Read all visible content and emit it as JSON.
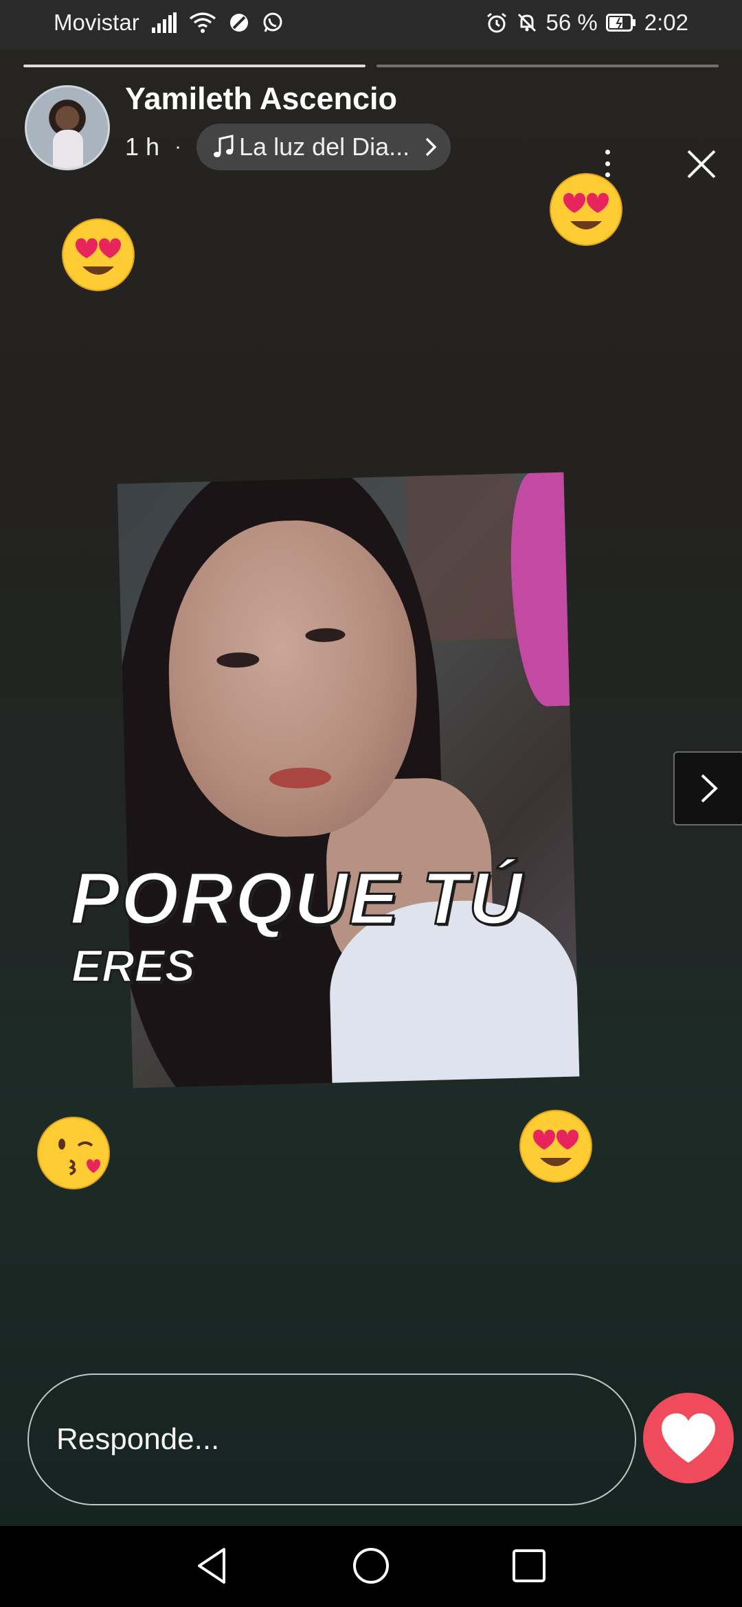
{
  "status_bar": {
    "carrier": "Movistar",
    "battery": "56 %",
    "time": "2:02",
    "icons": [
      "signal-icon",
      "wifi-icon",
      "blocked-icon",
      "whatsapp-icon",
      "alarm-icon",
      "mute-icon",
      "battery-icon"
    ]
  },
  "story": {
    "progress_segments": 2,
    "active_segment": 1,
    "username": "Yamileth Ascencio",
    "time_ago": "1 h",
    "separator": "·",
    "music_title": "La luz del Dia...",
    "overlay_title": "PORQUE TÚ",
    "overlay_subtitle": "ERES",
    "stickers": [
      "heart-eyes-emoji",
      "heart-eyes-emoji",
      "kissing-heart-emoji",
      "heart-eyes-emoji"
    ]
  },
  "reply": {
    "placeholder": "Responde..."
  },
  "colors": {
    "like_button": "#ef4b5d",
    "status_bar_bg": "#2a2a2a",
    "nav_bar_bg": "#000000"
  }
}
